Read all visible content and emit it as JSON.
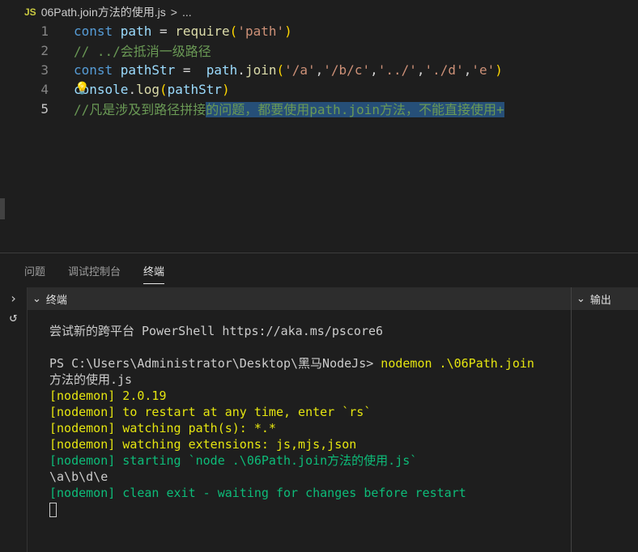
{
  "breadcrumb": {
    "lang": "JS",
    "file": "06Path.join方法的使用.js",
    "sep": ">",
    "more": "..."
  },
  "editor": {
    "lines": [
      {
        "n": "1",
        "tokens": [
          {
            "t": "const ",
            "c": "#569cd6"
          },
          {
            "t": "path",
            "c": "#9cdcfe"
          },
          {
            "t": " = ",
            "c": "#d4d4d4"
          },
          {
            "t": "require",
            "c": "#dcdcaa"
          },
          {
            "t": "(",
            "c": "#ffd700"
          },
          {
            "t": "'path'",
            "c": "#ce9178"
          },
          {
            "t": ")",
            "c": "#ffd700"
          }
        ]
      },
      {
        "n": "2",
        "tokens": [
          {
            "t": "// ../会抵消一级路径",
            "c": "#6a9955"
          }
        ]
      },
      {
        "n": "3",
        "tokens": [
          {
            "t": "const ",
            "c": "#569cd6"
          },
          {
            "t": "pathStr",
            "c": "#9cdcfe"
          },
          {
            "t": " =  ",
            "c": "#d4d4d4"
          },
          {
            "t": "path",
            "c": "#9cdcfe"
          },
          {
            "t": ".",
            "c": "#d4d4d4"
          },
          {
            "t": "join",
            "c": "#dcdcaa"
          },
          {
            "t": "(",
            "c": "#ffd700"
          },
          {
            "t": "'/a'",
            "c": "#ce9178"
          },
          {
            "t": ",",
            "c": "#d4d4d4"
          },
          {
            "t": "'/b/c'",
            "c": "#ce9178"
          },
          {
            "t": ",",
            "c": "#d4d4d4"
          },
          {
            "t": "'../'",
            "c": "#ce9178"
          },
          {
            "t": ",",
            "c": "#d4d4d4"
          },
          {
            "t": "'./d'",
            "c": "#ce9178"
          },
          {
            "t": ",",
            "c": "#d4d4d4"
          },
          {
            "t": "'e'",
            "c": "#ce9178"
          },
          {
            "t": ")",
            "c": "#ffd700"
          }
        ]
      },
      {
        "n": "4",
        "tokens": [
          {
            "t": "console",
            "c": "#9cdcfe"
          },
          {
            "t": ".",
            "c": "#d4d4d4"
          },
          {
            "t": "log",
            "c": "#dcdcaa"
          },
          {
            "t": "(",
            "c": "#ffd700"
          },
          {
            "t": "pathStr",
            "c": "#9cdcfe"
          },
          {
            "t": ")",
            "c": "#ffd700"
          }
        ]
      },
      {
        "n": "5",
        "tokens": [
          {
            "t": "//凡是涉及到路径拼接",
            "c": "#6a9955"
          },
          {
            "t": "的问题，都要使用path.join方法，不能直接使用+",
            "c": "#6a9955",
            "sel": true
          }
        ]
      }
    ]
  },
  "panel": {
    "tabs": [
      "问题",
      "调试控制台",
      "终端"
    ],
    "active_tab": 2,
    "terminal_header": "终端",
    "output_header": "输出"
  },
  "terminal": {
    "lines": [
      {
        "t": "尝试新的跨平台 PowerShell https://aka.ms/pscore6",
        "c": "#cccccc"
      },
      {
        "t": "",
        "c": "#cccccc"
      },
      {
        "t": "PS C:\\Users\\Administrator\\Desktop\\黑马NodeJs> ",
        "c": "#cccccc",
        "cmd": "nodemon .\\06Path.join"
      },
      {
        "t": "方法的使用.js",
        "c": "#cccccc"
      },
      {
        "t": "[nodemon] 2.0.19",
        "c": "#e5e510"
      },
      {
        "t": "[nodemon] to restart at any time, enter `rs`",
        "c": "#e5e510"
      },
      {
        "t": "[nodemon] watching path(s): *.*",
        "c": "#e5e510"
      },
      {
        "t": "[nodemon] watching extensions: js,mjs,json",
        "c": "#e5e510"
      },
      {
        "t": "[nodemon] starting `node .\\06Path.join方法的使用.js`",
        "c": "#0dbc79"
      },
      {
        "t": "\\a\\b\\d\\e",
        "c": "#cccccc"
      },
      {
        "t": "[nodemon] clean exit - waiting for changes before restart",
        "c": "#0dbc79"
      }
    ]
  }
}
